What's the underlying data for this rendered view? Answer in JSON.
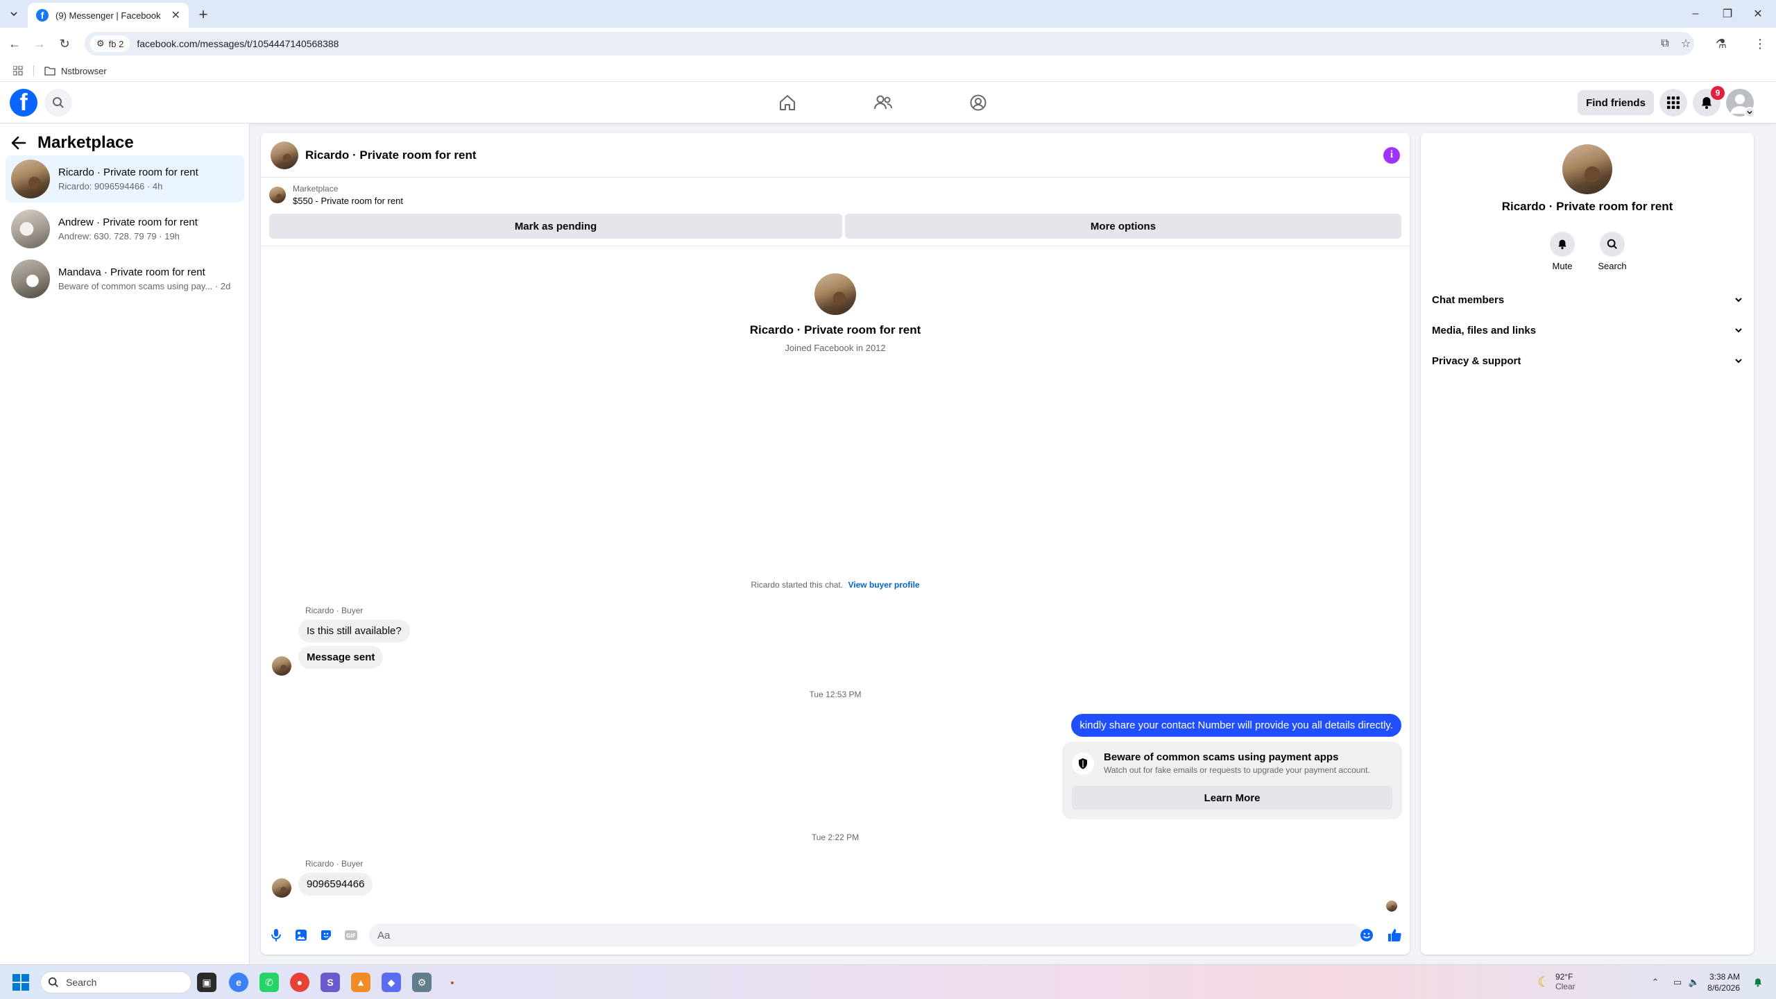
{
  "browser": {
    "tab_title": "(9) Messenger | Facebook",
    "profile_chip": "fb 2",
    "url": "facebook.com/messages/t/1054447140568388",
    "bookmark_folder": "Nstbrowser"
  },
  "header": {
    "find_friends": "Find friends",
    "notification_count": "9"
  },
  "sidebar": {
    "title": "Marketplace",
    "conversations": [
      {
        "name": "Ricardo · Private room for rent",
        "snippet": "Ricardo: 9096594466 · 4h"
      },
      {
        "name": "Andrew · Private room for rent",
        "snippet": "Andrew: 630. 728. 79 79 · 19h"
      },
      {
        "name": "Mandava · Private room for rent",
        "snippet": "Beware of common scams using pay... · 2d"
      }
    ]
  },
  "chat": {
    "title": "Ricardo · Private room for rent",
    "marketplace_label": "Marketplace",
    "listing": "$550 - Private room for rent",
    "mark_pending": "Mark as pending",
    "more_options": "More options",
    "intro_name": "Ricardo · Private room for rent",
    "intro_sub": "Joined Facebook in 2012",
    "started_text": "Ricardo started this chat.",
    "view_profile": "View buyer profile",
    "sender1": "Ricardo · Buyer",
    "msg1": "Is this still available?",
    "msg2": "Message sent",
    "time1": "Tue 12:53 PM",
    "out_msg": "kindly share your contact Number will provide you all details directly.",
    "scam_title": "Beware of common scams using payment apps",
    "scam_desc": "Watch out for fake emails or requests to upgrade your payment account.",
    "learn_more": "Learn More",
    "time2": "Tue 2:22 PM",
    "sender2": "Ricardo · Buyer",
    "msg3": "9096594466",
    "composer_placeholder": "Aa"
  },
  "panel": {
    "name": "Ricardo · Private room for rent",
    "mute": "Mute",
    "search": "Search",
    "rows": [
      "Chat members",
      "Media, files and links",
      "Privacy & support"
    ]
  },
  "taskbar": {
    "search_placeholder": "Search",
    "temp": "92°F",
    "weather": "Clear",
    "time": "3:38 AM",
    "date": "8/6/2026"
  },
  "colors": {
    "fb_blue": "#0866ff",
    "out_bubble": "#1f4fff",
    "info_purple": "#a033ff",
    "badge_red": "#e41e3f"
  }
}
